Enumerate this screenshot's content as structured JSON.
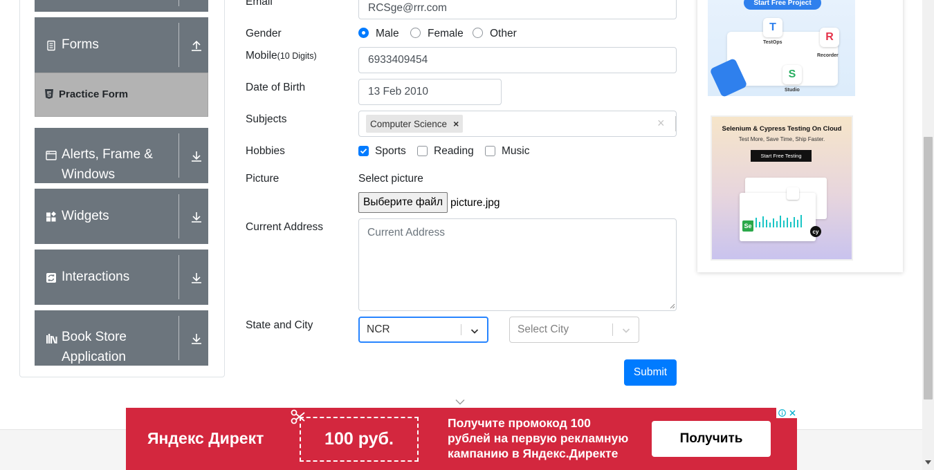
{
  "sidebar": {
    "forms_label": "Forms",
    "practice_form_label": "Practice Form",
    "alerts_label": "Alerts, Frame & Windows",
    "widgets_label": "Widgets",
    "interactions_label": "Interactions",
    "bookstore_label": "Book Store Application"
  },
  "form": {
    "email_label": "Email",
    "email_value": "RCSge@rrr.com",
    "gender_label": "Gender",
    "gender_options": [
      "Male",
      "Female",
      "Other"
    ],
    "gender_selected": "Male",
    "mobile_label": "Mobile",
    "mobile_hint": "(10 Digits)",
    "mobile_value": "6933409454",
    "dob_label": "Date of Birth",
    "dob_value": "13 Feb 2010",
    "subjects_label": "Subjects",
    "subject_chip": "Computer Science",
    "subject_chip_remove": "×",
    "subjects_clear": "×",
    "hobbies_label": "Hobbies",
    "hobbies": [
      "Sports",
      "Reading",
      "Music"
    ],
    "hobbies_checked": [
      "Sports"
    ],
    "picture_label": "Picture",
    "picture_prompt": "Select picture",
    "file_button": "Выберите файл",
    "file_name": "picture.jpg",
    "address_label": "Current Address",
    "address_placeholder": "Current Address",
    "state_city_label": "State and City",
    "state_value": "NCR",
    "city_placeholder": "Select City",
    "submit_label": "Submit"
  },
  "side_ads": {
    "ad1_button": "Start Free Project",
    "ad1_labels": [
      "TestOps",
      "Recorder",
      "Studio"
    ],
    "ad2_title": "Selenium & Cypress Testing On Cloud",
    "ad2_subtitle": "Test More, Save Time, Ship Faster.",
    "ad2_button": "Start Free Testing"
  },
  "bottom_ad": {
    "brand": "Яндекс Директ",
    "coupon": "100 руб.",
    "text_lines": [
      "Получите промокод 100",
      "рублей на первую рекламную",
      "кампанию в Яндекс.Директе"
    ],
    "cta": "Получить"
  },
  "colors": {
    "primary": "#007bff",
    "sidebar_group": "#6c757d",
    "ad_red": "#d3273e"
  }
}
